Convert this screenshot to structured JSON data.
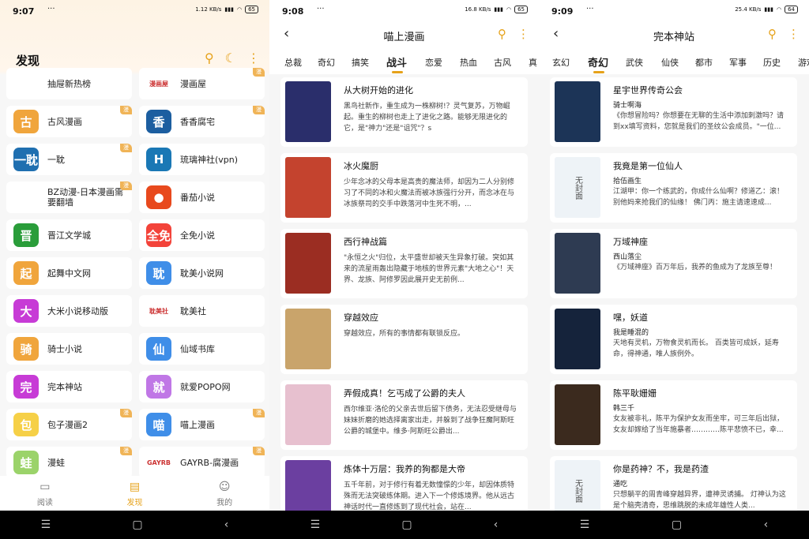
{
  "screen1": {
    "status": {
      "time": "9:07",
      "dots": "···",
      "net": "1.12 KB/s",
      "battery": "65"
    },
    "title": "发现",
    "grid": [
      {
        "label": "抽屉新热榜",
        "icon": "",
        "color": "#ffffff",
        "tag": ""
      },
      {
        "label": "漫画屋",
        "icon": "漫画屋",
        "color": "#ffffff",
        "tag": "漫"
      },
      {
        "label": "古风漫画",
        "icon": "古",
        "color": "#f0a53c",
        "tag": "漫"
      },
      {
        "label": "香香腐宅",
        "icon": "香",
        "color": "#1c5ea0",
        "tag": "漫"
      },
      {
        "label": "一耽",
        "icon": "一耽",
        "color": "#1f6fb0",
        "tag": "漫"
      },
      {
        "label": "琉璃神社(vpn)",
        "icon": "H",
        "color": "#1a78b5",
        "tag": ""
      },
      {
        "label": "BZ动漫-日本漫画需要翻墙",
        "icon": "",
        "color": "#ffffff",
        "tag": "漫"
      },
      {
        "label": "番茄小说",
        "icon": "●",
        "color": "#e8491d",
        "tag": ""
      },
      {
        "label": "晋江文学城",
        "icon": "晋",
        "color": "#2a9d3a",
        "tag": ""
      },
      {
        "label": "全免小说",
        "icon": "全免",
        "color": "#f3433a",
        "tag": ""
      },
      {
        "label": "起舞中文网",
        "icon": "起",
        "color": "#f0a53c",
        "tag": ""
      },
      {
        "label": "耽美小说网",
        "icon": "耽",
        "color": "#3f8ee8",
        "tag": ""
      },
      {
        "label": "大米小说移动版",
        "icon": "大",
        "color": "#c73bd6",
        "tag": ""
      },
      {
        "label": "耽美社",
        "icon": "耽美社",
        "color": "#ffffff",
        "tag": ""
      },
      {
        "label": "骑士小说",
        "icon": "骑",
        "color": "#f0a53c",
        "tag": ""
      },
      {
        "label": "仙域书库",
        "icon": "仙",
        "color": "#3f8ee8",
        "tag": ""
      },
      {
        "label": "完本神站",
        "icon": "完",
        "color": "#c73bd6",
        "tag": ""
      },
      {
        "label": "就爱POPO网",
        "icon": "就",
        "color": "#c077e6",
        "tag": ""
      },
      {
        "label": "包子漫画2",
        "icon": "包",
        "color": "#f6d047",
        "tag": "漫"
      },
      {
        "label": "喵上漫画",
        "icon": "喵",
        "color": "#3f8ee8",
        "tag": "漫"
      },
      {
        "label": "漫蛙",
        "icon": "蛙",
        "color": "#9bd36a",
        "tag": "漫"
      },
      {
        "label": "GAYRB-腐漫画",
        "icon": "GAYRB",
        "color": "#ffffff",
        "tag": "漫"
      }
    ],
    "nav": [
      {
        "label": "阅读",
        "icon": "▭"
      },
      {
        "label": "发现",
        "icon": "▤"
      },
      {
        "label": "我的",
        "icon": "☺"
      }
    ]
  },
  "screen2": {
    "status": {
      "time": "9:08",
      "dots": "···",
      "net": "16.8 KB/s",
      "battery": "65"
    },
    "title": "喵上漫画",
    "tabs": [
      "总裁",
      "奇幻",
      "搞笑",
      "战斗",
      "恋爱",
      "热血",
      "古风",
      "真"
    ],
    "active_tab": "战斗",
    "items": [
      {
        "title": "从大树开始的进化",
        "desc": "黑鸟社新作，重生成为一株柳树!？灵气复苏，万物崛起。重生的柳树也走上了进化之路。能够无限进化的它，是\"神力\"还是\"诅咒\"？s",
        "color": "#2a2e6b"
      },
      {
        "title": "冰火魔厨",
        "desc": "少年念冰的父母本是高贵的魔法师，却因为二人分别修习了不同的冰和火魔法而被冰族强行分开，而念冰在与冰族祭司的交手中跌落河中生死不明，...",
        "color": "#c4432e"
      },
      {
        "title": "西行神战篇",
        "desc": "\"永恒之火\"归位，太平盛世却被天生异象打破。突如其来的流星雨轰出隐藏于地核的世界元素\"大地之心\"！天界、龙族、阿修罗因此展开史无前例...",
        "color": "#9b2d22"
      },
      {
        "title": "穿越效应",
        "desc": "穿越效应，所有的事情都有联锁反应。",
        "color": "#c9a46b"
      },
      {
        "title": "弄假成真！乞丐成了公爵的夫人",
        "desc": "西尔维亚·洛伦的父亲去世后留下债务，无法忍受继母与妹妹折磨的她选择离家出走，并躲到了战争狂魔阿斯旺公爵的城堡中。维多·阿斯旺公爵出...",
        "color": "#e7c0cf"
      },
      {
        "title": "炼体十万层：我养的狗都是大帝",
        "desc": "五千年前，对于修行有着无数憧憬的少年，却因体质特殊而无法突破练体期。进入下一个修炼境界。他从远古神话时代一直修炼到了现代社会，站在...",
        "color": "#6b3fa0"
      }
    ]
  },
  "screen3": {
    "status": {
      "time": "9:09",
      "dots": "···",
      "net": "25.4 KB/s",
      "battery": "64"
    },
    "title": "完本神站",
    "tabs": [
      "玄幻",
      "奇幻",
      "武侠",
      "仙侠",
      "都市",
      "军事",
      "历史",
      "游戏"
    ],
    "active_tab": "奇幻",
    "items": [
      {
        "title": "星宇世界传奇公会",
        "author": "骑士啊海",
        "desc": "《你想冒险吗？你想要在无聊的生活中添加刺激吗？请到xx填写资料，您就是我们的圣纹公会成员。\"一位...",
        "color": "#1c3457",
        "cover_text": ""
      },
      {
        "title": "我竟是第一位仙人",
        "author": "拾伍画生",
        "desc": "江湖甲：你一个练武的，你成什么仙啊？修道乙：滚！别他妈来抢我们的仙缘！    佛门丙：施主请速速成...",
        "color": "#eef3f7",
        "cover_text": "无封面"
      },
      {
        "title": "万域神座",
        "author": "西山落尘",
        "desc": "《万域神座》百万年后，我养的鱼成为了龙族至尊！",
        "color": "#2e3b52",
        "cover_text": ""
      },
      {
        "title": "嘿，妖道",
        "author": "我是睡混的",
        "desc": "天地有灵机，万物食灵机而长。    百类皆可成妖，延寿命，得神通，唯人族例外。",
        "color": "#15233b",
        "cover_text": ""
      },
      {
        "title": "陈平耿姗姗",
        "author": "韩三千",
        "desc": "女友被非礼，陈平为保护女友而坐牢，可三年后出狱，女友却嫁给了当年施暴者…………陈平悲愤不已，幸...",
        "color": "#3b2a1e",
        "cover_text": ""
      },
      {
        "title": "你是药神？不，我是药渣",
        "author": "通吃",
        "desc": "只想躺平的周青峰穿越异界，遭神灵诱捕。    灯神认为这是个脑壳清奇，思维跳脱的未成年雄性人类...",
        "color": "#eef3f7",
        "cover_text": "无封面"
      }
    ]
  },
  "system_nav": {
    "menu": "☰",
    "home": "▢",
    "back": "‹"
  }
}
